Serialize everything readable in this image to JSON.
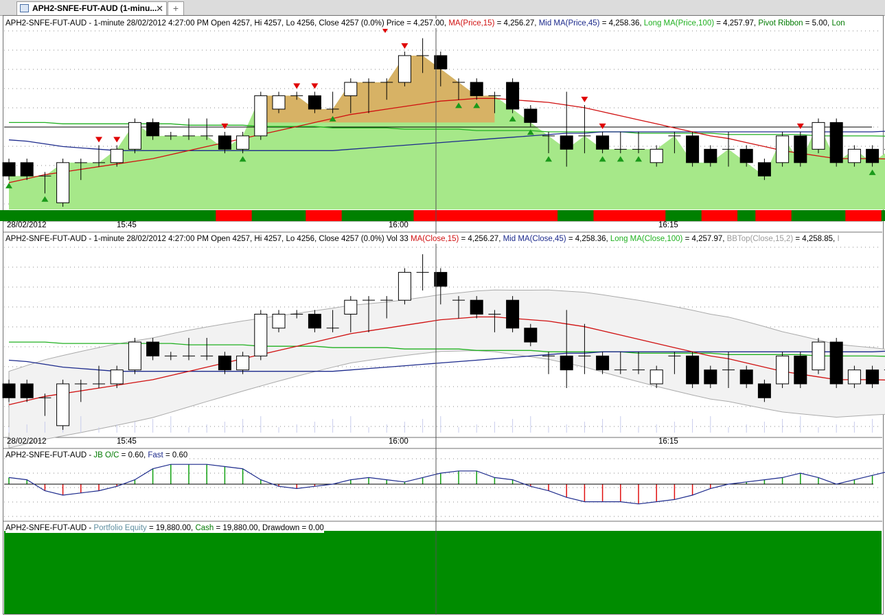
{
  "tab": {
    "label": "APH2-SNFE-FUT-AUD (1-minu...",
    "close": "✕",
    "add": "+"
  },
  "colors": {
    "up_fill": "#ffffff",
    "down_fill": "#000000",
    "ma_short": "#d01010",
    "ma_mid": "#1c2a8c",
    "ma_long": "#20b020",
    "ribbon_green": "#008000",
    "ribbon_red": "#ff0000",
    "equity": "#008c00"
  },
  "panel1": {
    "legend": {
      "prefix": "APH2-SNFE-FUT-AUD - 1-minute 28/02/2012 4:27:00 PM Open 4257, Hi 4257, Lo 4256, Close 4257 (0.0%) Price = 4,257.00, ",
      "ma_label": "MA(Price,15)",
      "ma_value": " = 4,256.27, ",
      "mid_label": "Mid MA(Price,45)",
      "mid_value": " = 4,258.36, ",
      "long_label": "Long MA(Price,100)",
      "long_value": " = 4,257.97, ",
      "pivot_label": "Pivot Ribbon",
      "pivot_value": " = 5.00, ",
      "trail": "Lon"
    }
  },
  "panel2": {
    "legend": {
      "prefix": "APH2-SNFE-FUT-AUD - 1-minute 28/02/2012 4:27:00 PM Open 4257, Hi 4257, Lo 4256, Close 4257 (0.0%) Vol 33 ",
      "ma_label": "MA(Close,15)",
      "ma_value": " = 4,256.27, ",
      "mid_label": "Mid MA(Close,45)",
      "mid_value": " = 4,258.36, ",
      "long_label": "Long MA(Close,100)",
      "long_value": " = 4,257.97, ",
      "bb_label": "BBTop(Close,15,2)",
      "bb_value": " = 4,258.85, ",
      "trail": "I"
    }
  },
  "panel3": {
    "legend": {
      "prefix": "APH2-SNFE-FUT-AUD - ",
      "jb_label": "JB O/C",
      "jb_value": " = 0.60, ",
      "fast_label": "Fast",
      "fast_value": " = 0.60"
    }
  },
  "panel4": {
    "legend": {
      "prefix": "APH2-SNFE-FUT-AUD - ",
      "eq_label": "Portfolio Equity",
      "eq_value": " = 19,880.00, ",
      "cash_label": "Cash",
      "cash_value": " = 19,880.00, ",
      "dd_label": "Drawdown = 0.00"
    }
  },
  "axis": {
    "date_label": "28/02/2012",
    "time_labels": [
      "15:45",
      "16:00",
      "16:15"
    ]
  },
  "chart_data": {
    "type": "candlestick",
    "interval": "1-minute",
    "date": "28/02/2012",
    "candles": [
      {
        "o": 4256,
        "h": 4256,
        "l": 4255,
        "c": 4255
      },
      {
        "o": 4256,
        "h": 4256,
        "l": 4255,
        "c": 4255
      },
      {
        "o": 4255,
        "h": 4255,
        "l": 4254,
        "c": 4255
      },
      {
        "o": 4253,
        "h": 4256,
        "l": 4253,
        "c": 4256
      },
      {
        "o": 4256,
        "h": 4256,
        "l": 4255,
        "c": 4256
      },
      {
        "o": 4256,
        "h": 4257,
        "l": 4256,
        "c": 4256
      },
      {
        "o": 4256,
        "h": 4257,
        "l": 4256,
        "c": 4257
      },
      {
        "o": 4257,
        "h": 4259,
        "l": 4257,
        "c": 4259
      },
      {
        "o": 4259,
        "h": 4259,
        "l": 4258,
        "c": 4258
      },
      {
        "o": 4258,
        "h": 4258,
        "l": 4258,
        "c": 4258
      },
      {
        "o": 4258,
        "h": 4259,
        "l": 4258,
        "c": 4258
      },
      {
        "o": 4258,
        "h": 4259,
        "l": 4258,
        "c": 4258
      },
      {
        "o": 4258,
        "h": 4258,
        "l": 4257,
        "c": 4257
      },
      {
        "o": 4257,
        "h": 4258,
        "l": 4257,
        "c": 4258
      },
      {
        "o": 4258,
        "h": 4261,
        "l": 4258,
        "c": 4261
      },
      {
        "o": 4260,
        "h": 4261,
        "l": 4260,
        "c": 4261
      },
      {
        "o": 4261,
        "h": 4261,
        "l": 4261,
        "c": 4261
      },
      {
        "o": 4261,
        "h": 4261,
        "l": 4260,
        "c": 4260
      },
      {
        "o": 4260,
        "h": 4261,
        "l": 4260,
        "c": 4260
      },
      {
        "o": 4261,
        "h": 4262,
        "l": 4260,
        "c": 4262
      },
      {
        "o": 4262,
        "h": 4262,
        "l": 4260,
        "c": 4262
      },
      {
        "o": 4262,
        "h": 4262,
        "l": 4261,
        "c": 4262
      },
      {
        "o": 4262,
        "h": 4264,
        "l": 4262,
        "c": 4264
      },
      {
        "o": 4264,
        "h": 4265,
        "l": 4263,
        "c": 4264
      },
      {
        "o": 4264,
        "h": 4264,
        "l": 4262,
        "c": 4263
      },
      {
        "o": 4262,
        "h": 4262,
        "l": 4261,
        "c": 4262
      },
      {
        "o": 4262,
        "h": 4262,
        "l": 4261,
        "c": 4261
      },
      {
        "o": 4261,
        "h": 4261,
        "l": 4260,
        "c": 4261
      },
      {
        "o": 4262,
        "h": 4262,
        "l": 4260,
        "c": 4260
      },
      {
        "o": 4260,
        "h": 4260,
        "l": 4259,
        "c": 4259
      },
      {
        "o": 4258,
        "h": 4258,
        "l": 4257,
        "c": 4258
      },
      {
        "o": 4258,
        "h": 4261,
        "l": 4256,
        "c": 4257
      },
      {
        "o": 4258,
        "h": 4260,
        "l": 4257,
        "c": 4258
      },
      {
        "o": 4258,
        "h": 4258,
        "l": 4257,
        "c": 4257
      },
      {
        "o": 4257,
        "h": 4258,
        "l": 4257,
        "c": 4257
      },
      {
        "o": 4257,
        "h": 4258,
        "l": 4257,
        "c": 4257
      },
      {
        "o": 4256,
        "h": 4257,
        "l": 4256,
        "c": 4257
      },
      {
        "o": 4258,
        "h": 4258,
        "l": 4257,
        "c": 4258
      },
      {
        "o": 4258,
        "h": 4258,
        "l": 4256,
        "c": 4256
      },
      {
        "o": 4257,
        "h": 4257,
        "l": 4256,
        "c": 4256
      },
      {
        "o": 4257,
        "h": 4258,
        "l": 4256,
        "c": 4257
      },
      {
        "o": 4257,
        "h": 4257,
        "l": 4256,
        "c": 4256
      },
      {
        "o": 4256,
        "h": 4256,
        "l": 4255,
        "c": 4255
      },
      {
        "o": 4256,
        "h": 4258,
        "l": 4256,
        "c": 4258
      },
      {
        "o": 4258,
        "h": 4258,
        "l": 4256,
        "c": 4256
      },
      {
        "o": 4257,
        "h": 4259,
        "l": 4257,
        "c": 4259
      },
      {
        "o": 4259,
        "h": 4259,
        "l": 4256,
        "c": 4256
      },
      {
        "o": 4256,
        "h": 4257,
        "l": 4256,
        "c": 4257
      },
      {
        "o": 4257,
        "h": 4257,
        "l": 4256,
        "c": 4256
      },
      {
        "o": 4257,
        "h": 4257,
        "l": 4256,
        "c": 4257
      }
    ],
    "ma_short": [
      4254.5,
      4254.8,
      4255.1,
      4255.3,
      4255.5,
      4255.7,
      4255.9,
      4256.1,
      4256.3,
      4256.6,
      4256.9,
      4257.2,
      4257.5,
      4257.8,
      4258.1,
      4258.4,
      4258.7,
      4259.0,
      4259.3,
      4259.6,
      4259.8,
      4260.0,
      4260.2,
      4260.4,
      4260.6,
      4260.7,
      4260.8,
      4260.8,
      4260.7,
      4260.6,
      4260.5,
      4260.3,
      4260.1,
      4259.8,
      4259.5,
      4259.2,
      4258.9,
      4258.6,
      4258.3,
      4258.0,
      4257.8,
      4257.5,
      4257.2,
      4256.9,
      4256.7,
      4256.5,
      4256.3,
      4256.3,
      4256.3,
      4256.27
    ],
    "ma_mid": [
      4257.7,
      4257.6,
      4257.4,
      4257.2,
      4257.1,
      4257.0,
      4256.9,
      4256.9,
      4256.9,
      4256.9,
      4256.9,
      4256.9,
      4256.9,
      4256.9,
      4256.9,
      4256.9,
      4256.9,
      4256.9,
      4256.9,
      4257.0,
      4257.1,
      4257.2,
      4257.3,
      4257.4,
      4257.5,
      4257.6,
      4257.7,
      4257.8,
      4257.9,
      4258.0,
      4258.1,
      4258.2,
      4258.2,
      4258.3,
      4258.3,
      4258.3,
      4258.3,
      4258.3,
      4258.3,
      4258.3,
      4258.3,
      4258.3,
      4258.3,
      4258.3,
      4258.3,
      4258.3,
      4258.3,
      4258.3,
      4258.3,
      4258.36
    ],
    "ma_long": [
      4259.0,
      4259.0,
      4259.0,
      4258.9,
      4258.9,
      4258.9,
      4258.9,
      4258.9,
      4258.9,
      4258.9,
      4258.8,
      4258.8,
      4258.8,
      4258.8,
      4258.7,
      4258.7,
      4258.7,
      4258.7,
      4258.6,
      4258.6,
      4258.6,
      4258.6,
      4258.5,
      4258.5,
      4258.5,
      4258.5,
      4258.4,
      4258.4,
      4258.4,
      4258.4,
      4258.3,
      4258.3,
      4258.3,
      4258.3,
      4258.3,
      4258.2,
      4258.2,
      4258.2,
      4258.2,
      4258.2,
      4258.1,
      4258.1,
      4258.1,
      4258.1,
      4258.1,
      4258.0,
      4258.0,
      4258.0,
      4258.0,
      4257.97
    ],
    "pivot_ribbon": [
      "G",
      "G",
      "G",
      "G",
      "G",
      "G",
      "G",
      "G",
      "G",
      "G",
      "G",
      "G",
      "R",
      "R",
      "G",
      "G",
      "G",
      "R",
      "R",
      "G",
      "G",
      "G",
      "G",
      "R",
      "R",
      "R",
      "R",
      "R",
      "R",
      "R",
      "R",
      "G",
      "G",
      "R",
      "R",
      "R",
      "R",
      "G",
      "G",
      "R",
      "R",
      "G",
      "R",
      "R",
      "G",
      "G",
      "G",
      "R",
      "R",
      "G"
    ],
    "jb_oc": [
      0.3,
      0.2,
      -0.3,
      -0.5,
      -0.4,
      -0.3,
      -0.1,
      0.2,
      0.7,
      0.9,
      0.9,
      0.9,
      0.8,
      0.7,
      0.2,
      -0.1,
      -0.2,
      -0.1,
      0.0,
      0.2,
      0.3,
      0.2,
      0.1,
      0.3,
      0.5,
      0.6,
      0.6,
      0.3,
      0.2,
      -0.1,
      -0.3,
      -0.6,
      -0.8,
      -0.8,
      -0.8,
      -0.9,
      -0.8,
      -0.7,
      -0.5,
      -0.2,
      0.0,
      0.1,
      0.2,
      0.3,
      0.5,
      0.3,
      0.0,
      0.2,
      0.4,
      0.6
    ],
    "portfolio_equity": 19880.0,
    "cash": 19880.0,
    "drawdown": 0.0,
    "x_ticks": [
      "15:45",
      "16:00",
      "16:15"
    ]
  }
}
